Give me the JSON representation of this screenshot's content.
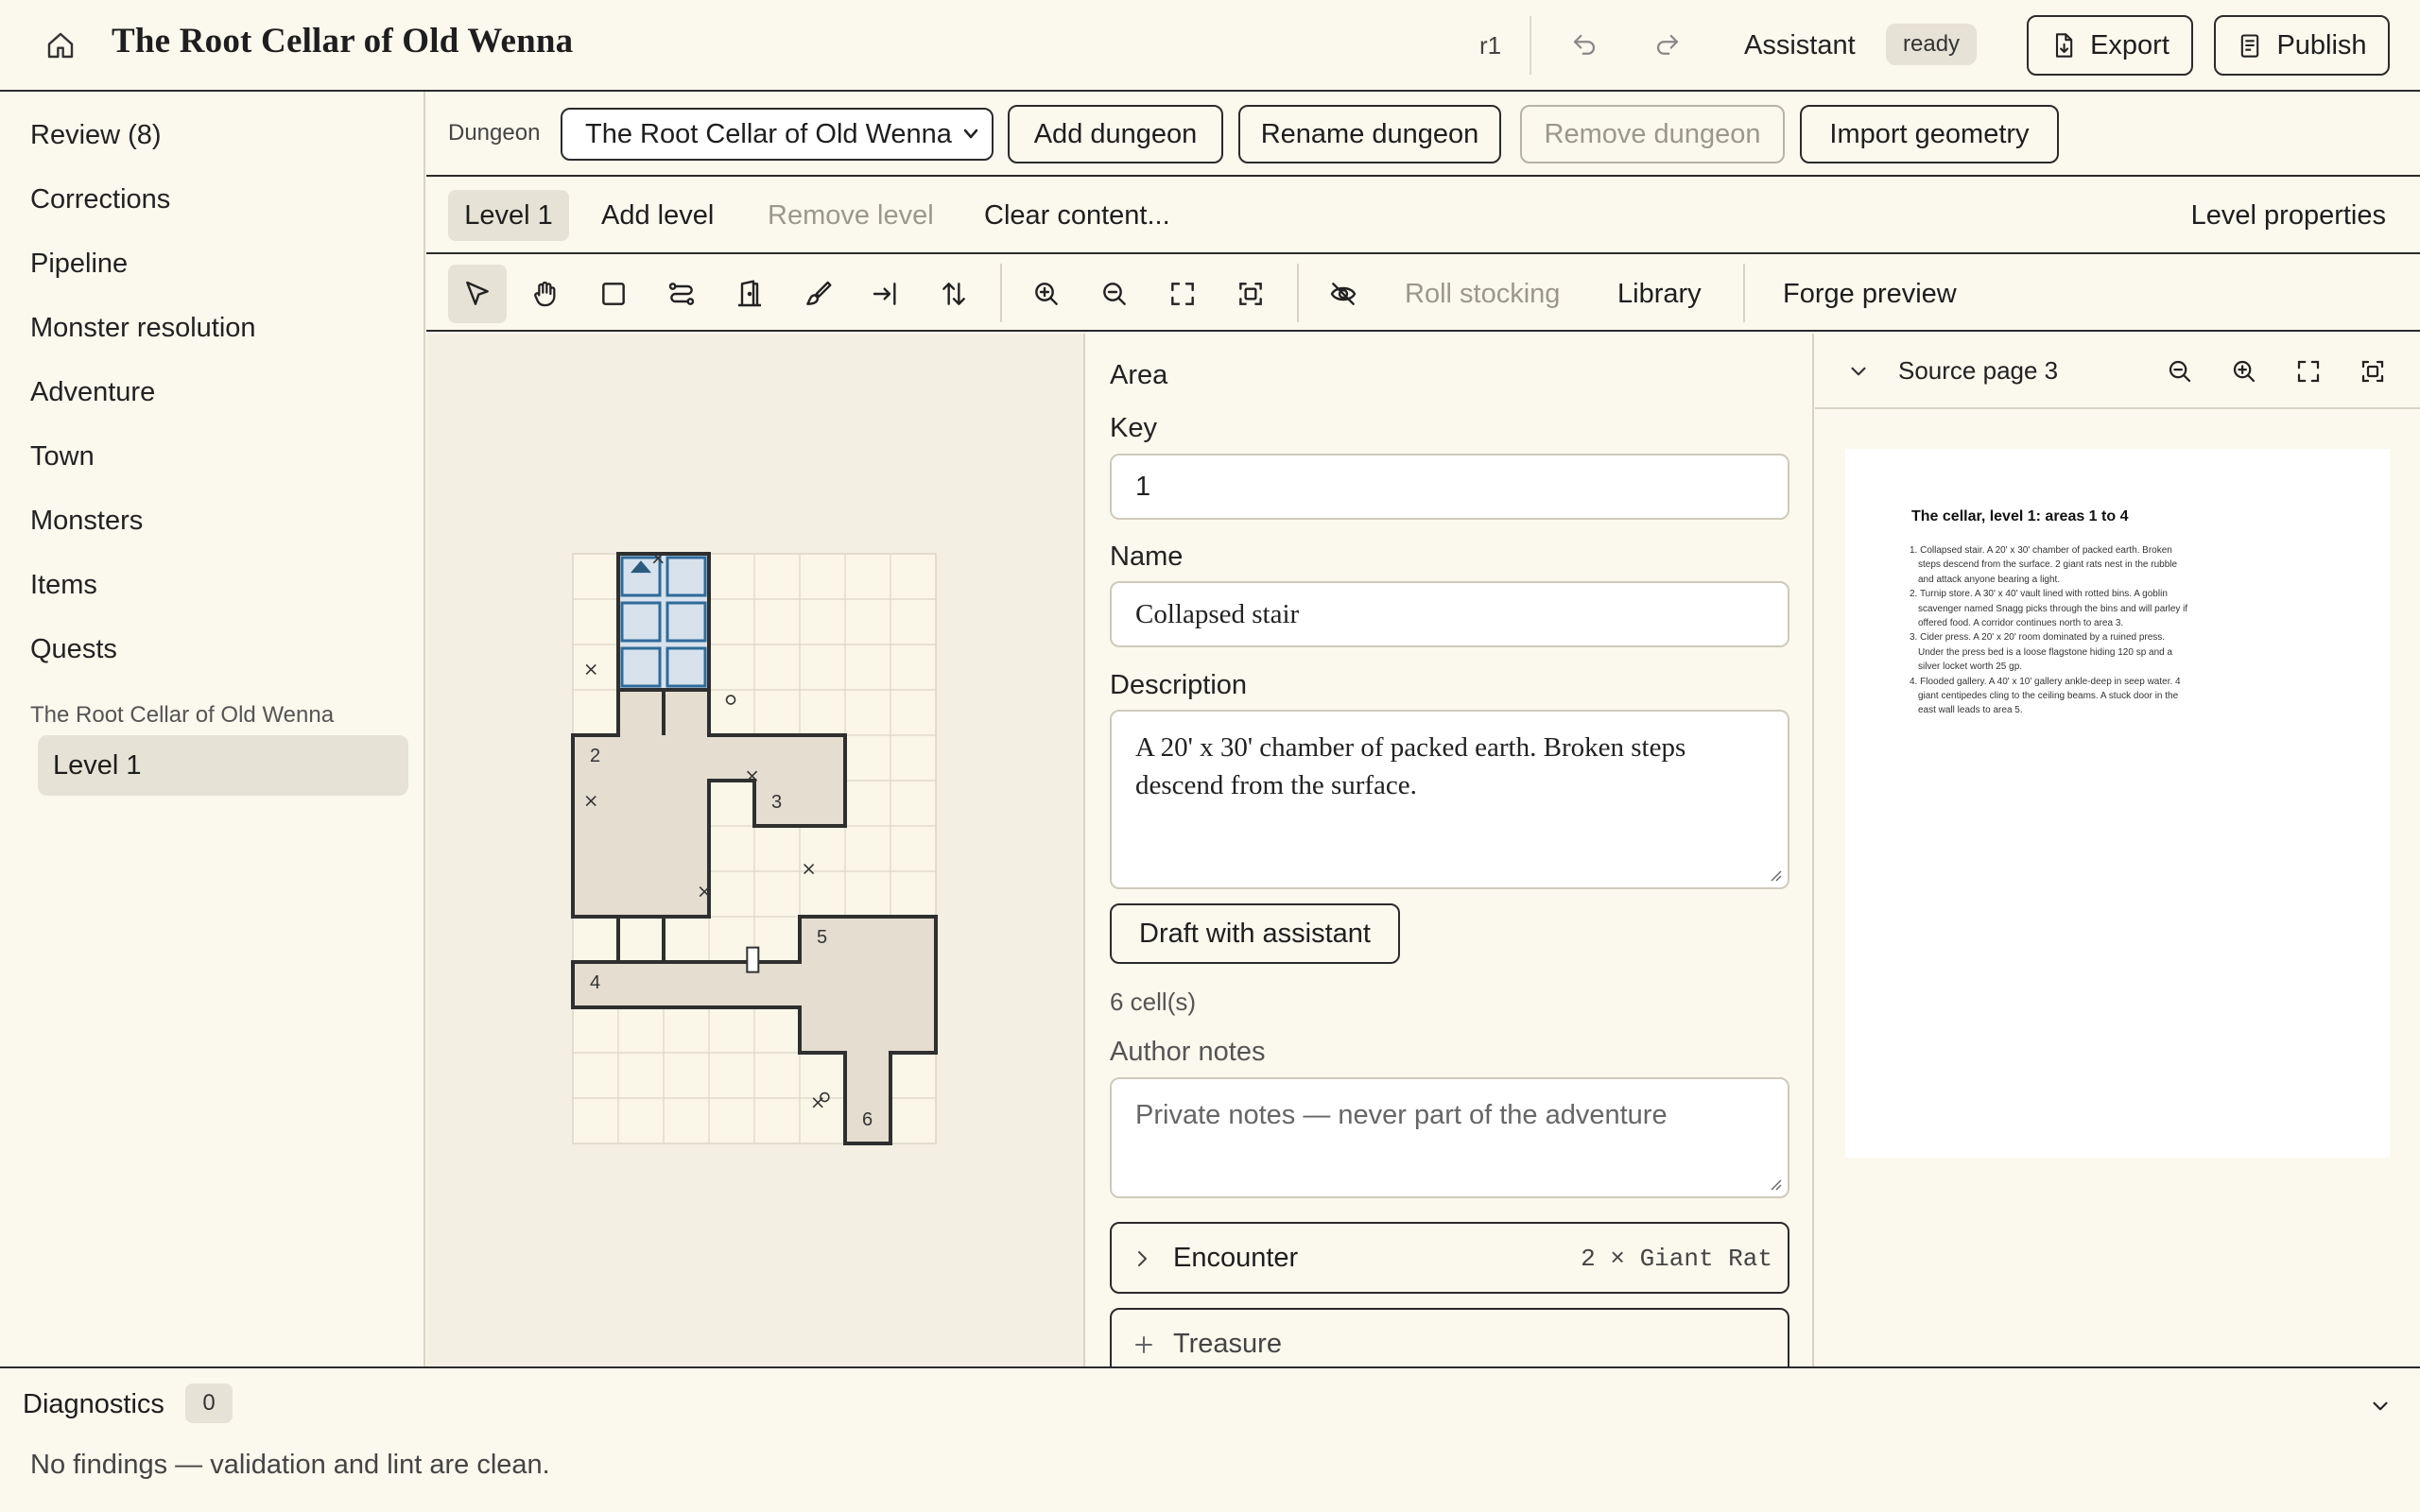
{
  "app": {
    "title": "The Root Cellar of Old Wenna",
    "revision": "r1",
    "assistant_label": "Assistant",
    "assistant_status": "ready",
    "export_label": "Export",
    "publish_label": "Publish"
  },
  "sidebar": {
    "items": [
      {
        "label": "Review (8)"
      },
      {
        "label": "Corrections"
      },
      {
        "label": "Pipeline"
      },
      {
        "label": "Monster resolution"
      },
      {
        "label": "Adventure"
      },
      {
        "label": "Town"
      },
      {
        "label": "Monsters"
      },
      {
        "label": "Items"
      },
      {
        "label": "Quests"
      }
    ],
    "group_label": "The Root Cellar of Old Wenna",
    "group_item": "Level 1"
  },
  "dungeon_bar": {
    "label": "Dungeon",
    "selected": "The Root Cellar of Old Wenna",
    "add": "Add dungeon",
    "rename": "Rename dungeon",
    "remove": "Remove dungeon",
    "import": "Import geometry"
  },
  "level_bar": {
    "current": "Level 1",
    "add": "Add level",
    "remove": "Remove level",
    "clear": "Clear content...",
    "properties": "Level properties"
  },
  "tools": {
    "icons": [
      "select-arrow-icon",
      "pan-hand-icon",
      "room-rect-icon",
      "corridor-icon",
      "door-icon",
      "paint-brush-icon",
      "entrance-icon",
      "stairs-icon",
      "zoom-in-icon",
      "zoom-out-icon",
      "fit-icon",
      "fit-selection-icon",
      "hide-eye-icon"
    ],
    "roll_stocking": "Roll stocking",
    "library": "Library",
    "forge_preview": "Forge preview"
  },
  "map": {
    "room_labels": [
      "2",
      "3",
      "4",
      "5",
      "6"
    ],
    "colors": {
      "room_fill": "#e4ddd0",
      "wall": "#2f2f2f",
      "grid": "#dcd6c6",
      "selected": "#2f6b9a"
    }
  },
  "area": {
    "heading": "Area",
    "key_label": "Key",
    "key_value": "1",
    "name_label": "Name",
    "name_value": "Collapsed stair",
    "description_label": "Description",
    "description_value": "A 20' x 30' chamber of packed earth. Broken steps descend from the surface.",
    "draft_button": "Draft with assistant",
    "cell_count": "6 cell(s)",
    "notes_label": "Author notes",
    "notes_placeholder": "Private notes — never part of the adventure",
    "encounter_label": "Encounter",
    "encounter_value": "2 × Giant Rat",
    "treasure_label": "Treasure"
  },
  "source": {
    "title": "Source page 3",
    "page_heading": "The cellar, level 1: areas 1 to 4",
    "page_lines": [
      "1. Collapsed stair. A 20' x 30' chamber of packed earth. Broken steps descend from the surface. 2 giant rats nest in the rubble and attack anyone bearing a light.",
      "2. Turnip store. A 30' x 40' vault lined with rotted bins. A goblin scavenger named Snagg picks through the bins and will parley if offered food. A corridor continues north to area 3.",
      "3. Cider press. A 20' x 20' room dominated by a ruined press. Under the press bed is a loose flagstone hiding 120 sp and a silver locket worth 25 gp.",
      "4. Flooded gallery. A 40' x 10' gallery ankle-deep in seep water. 4 giant centipedes cling to the ceiling beams. A stuck door in the east wall leads to area 5."
    ]
  },
  "diagnostics": {
    "title": "Diagnostics",
    "count": "0",
    "message": "No findings — validation and lint are clean."
  }
}
